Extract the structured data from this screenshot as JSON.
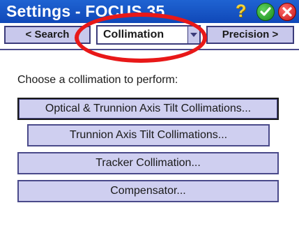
{
  "window": {
    "title": "Settings - FOCUS 35",
    "icons": {
      "help": "question-mark-icon",
      "ok": "checkmark-icon",
      "close": "close-x-icon"
    }
  },
  "tabs": {
    "prev_label": "< Search",
    "current": "Collimation",
    "next_label": "Precision >"
  },
  "content": {
    "prompt": "Choose a collimation to perform:",
    "buttons": [
      {
        "label": "Optical & Trunnion Axis Tilt Collimations..."
      },
      {
        "label": "Trunnion Axis Tilt Collimations..."
      },
      {
        "label": "Tracker Collimation..."
      },
      {
        "label": "Compensator..."
      }
    ]
  },
  "annotation": {
    "type": "ellipse",
    "color": "#e81818",
    "target": "tab-selector"
  },
  "colors": {
    "titlebar": "#1048b8",
    "button_fill": "#cfcff0",
    "button_border": "#4a4a8a"
  }
}
